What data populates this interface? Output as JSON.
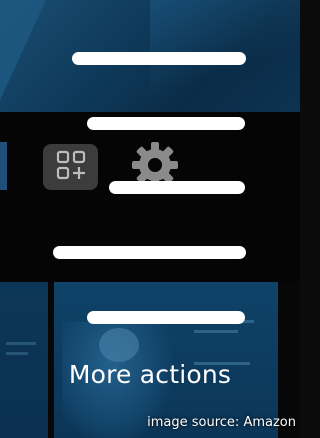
{
  "caption": "More actions",
  "credit": "image source: Amazon",
  "icons": {
    "apps": "add-apps-icon",
    "settings": "gear-icon"
  },
  "colors": {
    "background": "#070707",
    "accent_blue": "#0f3a5b",
    "tile_gray": "#3c3c3c",
    "pill": "#ffffff"
  }
}
